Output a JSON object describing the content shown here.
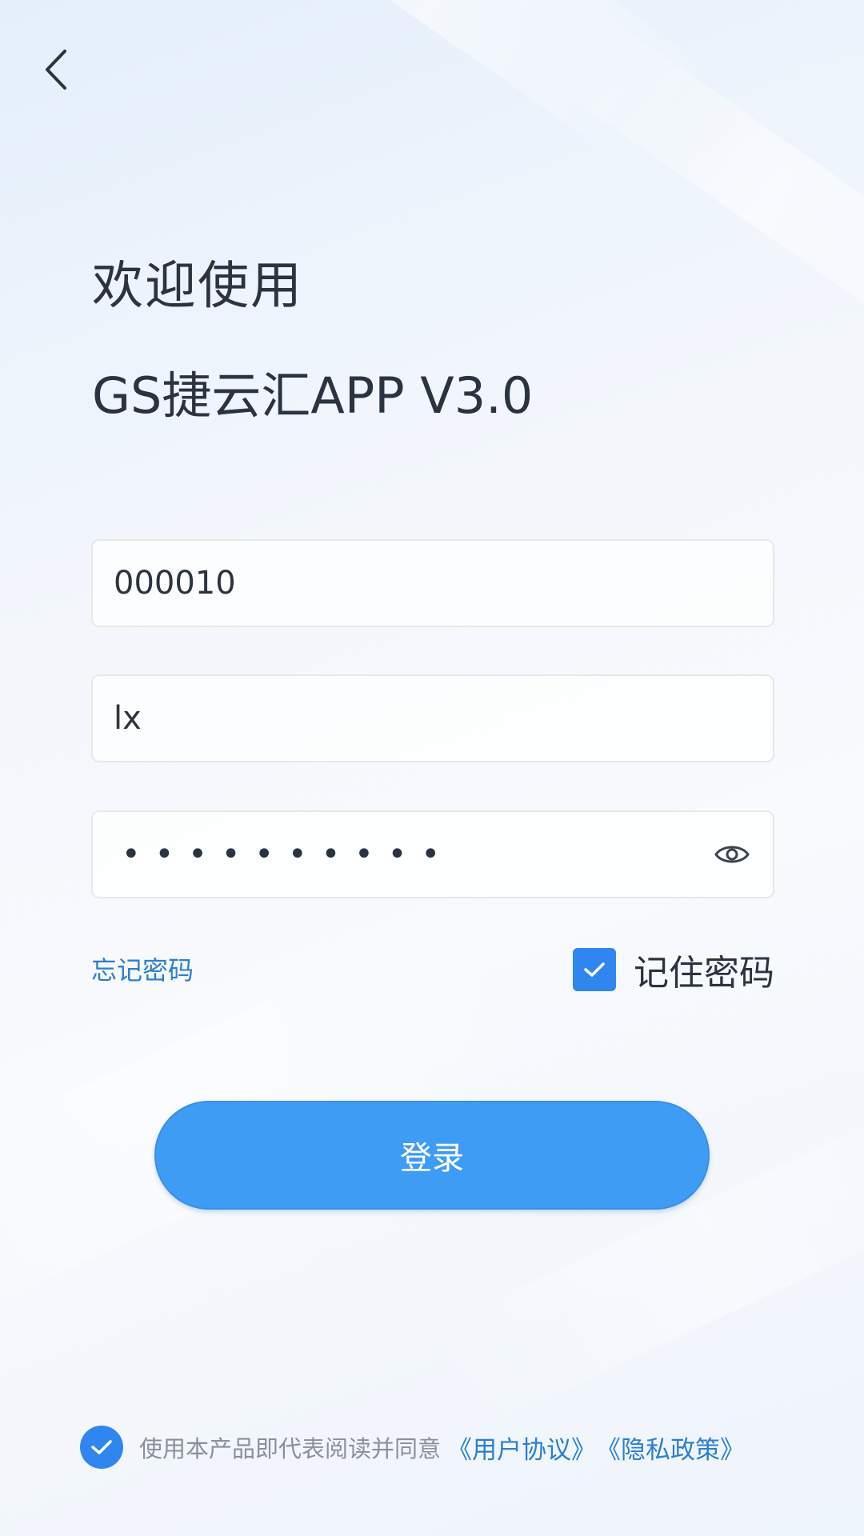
{
  "header": {
    "welcome_text": "欢迎使用",
    "app_name": "GS捷云汇APP V3.0"
  },
  "form": {
    "company_code": "000010",
    "username": "lx",
    "password_mask": "••••••••••",
    "forgot_password_label": "忘记密码",
    "remember_password_label": "记住密码",
    "remember_password_checked": true,
    "login_button_label": "登录"
  },
  "agreement": {
    "checked": true,
    "text": "使用本产品即代表阅读并同意",
    "user_agreement_link": "《用户协议》",
    "privacy_policy_link": "《隐私政策》"
  },
  "icons": {
    "back": "chevron-left-icon",
    "eye": "eye-icon",
    "check": "check-icon"
  },
  "colors": {
    "accent": "#3f9cf5",
    "link": "#2b7fd0",
    "checkbox": "#2f86ee",
    "text": "#2a3440"
  }
}
